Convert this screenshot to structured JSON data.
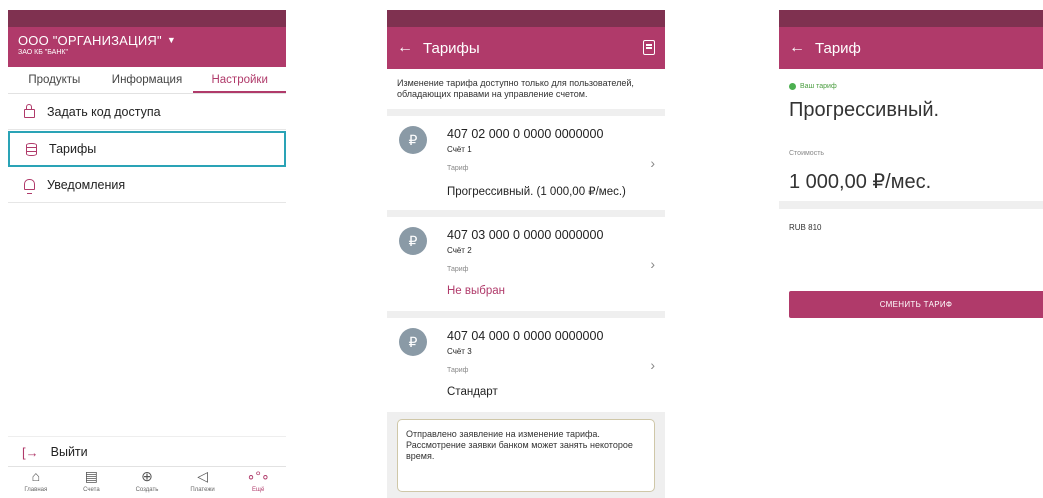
{
  "screen1": {
    "org_name": "ООО \"ОРГАНИЗАЦИЯ\"",
    "bank_name": "ЗАО КБ \"БАНК\"",
    "tabs": [
      {
        "label": "Продукты",
        "active": false
      },
      {
        "label": "Информация",
        "active": false
      },
      {
        "label": "Настройки",
        "active": true
      }
    ],
    "menu": [
      {
        "label": "Задать код доступа",
        "icon": "lock-icon"
      },
      {
        "label": "Тарифы",
        "icon": "database-icon",
        "highlighted": true
      },
      {
        "label": "Уведомления",
        "icon": "bell-icon"
      }
    ],
    "logout_label": "Выйти",
    "bottom_nav": [
      {
        "label": "Главная",
        "icon": "home-icon"
      },
      {
        "label": "Счета",
        "icon": "document-icon"
      },
      {
        "label": "Создать",
        "icon": "plus-circle-icon"
      },
      {
        "label": "Платежи",
        "icon": "paper-plane-icon"
      },
      {
        "label": "Ещё",
        "icon": "more-icon",
        "active": true
      }
    ]
  },
  "screen2": {
    "title": "Тарифы",
    "notice": "Изменение тарифа доступно только для пользователей, обладающих правами на управление счетом.",
    "accounts": [
      {
        "avatar": "₽",
        "number": "407 02 000 0 0000 0000000",
        "name": "Счёт 1",
        "tariff_label": "Тариф",
        "tariff": "Прогрессивный. (1 000,00 ₽/мес.)",
        "selected": true
      },
      {
        "avatar": "₽",
        "number": "407 03 000 0 0000 0000000",
        "name": "Счёт 2",
        "tariff_label": "Тариф",
        "tariff": "Не выбран",
        "selected": false
      },
      {
        "avatar": "₽",
        "number": "407 04 000 0 0000 0000000",
        "name": "Счёт 3",
        "tariff_label": "Тариф",
        "tariff": "Стандарт",
        "selected": true
      }
    ],
    "request_notice": "Отправлено заявление на изменение тарифа. Рассмотрение заявки банком может занять некоторое время."
  },
  "screen3": {
    "title": "Тариф",
    "badge": "Ваш тариф",
    "plan_name": "Прогрессивный.",
    "cost_label": "Стоимость",
    "price": "1 000,00 ₽/мес.",
    "currency": "RUB 810",
    "button_label": "СМЕНИТЬ ТАРИФ"
  },
  "colors": {
    "primary": "#b03a6a",
    "status_bar": "#7f3150",
    "highlight_border": "#2aa3b6",
    "active_badge": "#4caf50"
  }
}
